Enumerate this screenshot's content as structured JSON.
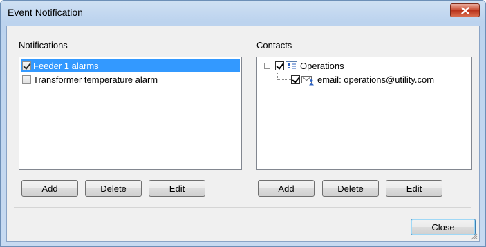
{
  "window": {
    "title": "Event Notification"
  },
  "notifications": {
    "label": "Notifications",
    "items": [
      {
        "label": "Feeder 1 alarms",
        "checked": true,
        "selected": true
      },
      {
        "label": "Transformer temperature alarm",
        "checked": false,
        "selected": false
      }
    ],
    "buttons": {
      "add": "Add",
      "delete": "Delete",
      "edit": "Edit"
    }
  },
  "contacts": {
    "label": "Contacts",
    "tree": {
      "group": {
        "label": "Operations",
        "checked": true,
        "icon": "contact-card-icon"
      },
      "child": {
        "label": "email: operations@utility.com",
        "checked": true,
        "icon": "email-contact-icon"
      }
    },
    "buttons": {
      "add": "Add",
      "delete": "Delete",
      "edit": "Edit"
    }
  },
  "footer": {
    "close_label": "Close"
  },
  "colors": {
    "selection": "#3399ff",
    "close_button": "#c6462c"
  }
}
